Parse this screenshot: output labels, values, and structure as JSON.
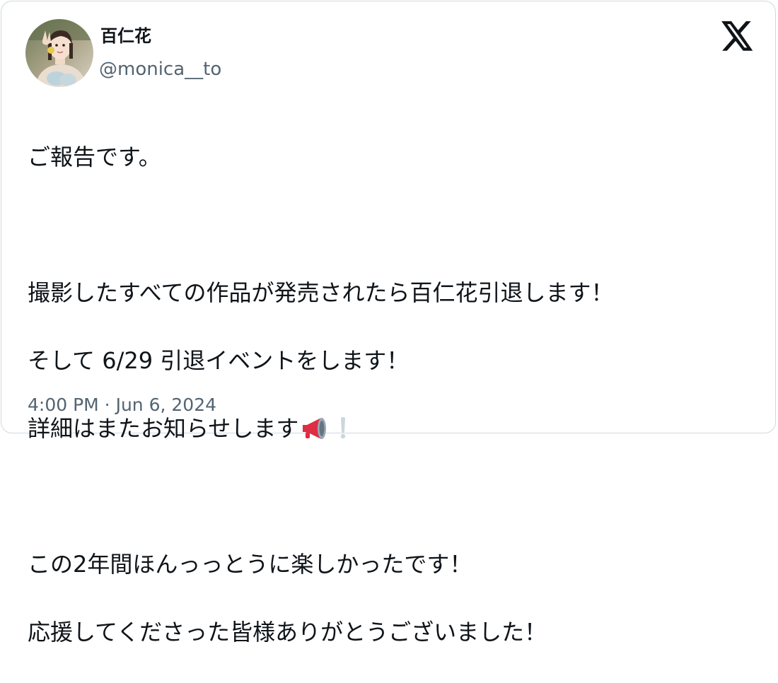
{
  "author": {
    "display_name": "百仁花",
    "handle": "@monica__to"
  },
  "logo_icon": "x-logo-icon",
  "tweet": {
    "line1": "ご報告です。",
    "line2": "撮影したすべての作品が発売されたら百仁花引退します！",
    "line3": "そして 6/29  引退イベントをします！",
    "line4": "詳細はまたお知らせします",
    "line4_emoji": [
      "megaphone-icon",
      "exclamation-icon"
    ],
    "line5": "この2年間ほんっっとうに楽しかったです！",
    "line6": "応援してくださった皆様ありがとうございました！"
  },
  "timestamp": "4:00 PM · Jun 6, 2024",
  "colors": {
    "text": "#0f1419",
    "secondary": "#536471",
    "border": "#cfd9de"
  }
}
